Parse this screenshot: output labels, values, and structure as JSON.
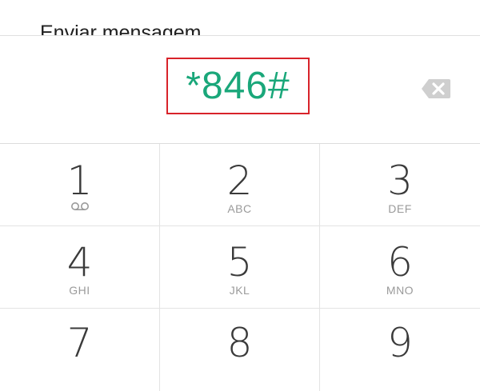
{
  "menu": {
    "send_message_label": "Enviar mensagem"
  },
  "display": {
    "number": "*846#"
  },
  "icons": {
    "backspace": "backspace-icon",
    "voicemail": "voicemail-icon"
  },
  "colors": {
    "number_text": "#1aa77a",
    "highlight_border": "#d8232a",
    "digit": "#3a3a3a",
    "letters": "#9a9a9a"
  },
  "keypad": {
    "keys": [
      {
        "digit": "1",
        "letters": ""
      },
      {
        "digit": "2",
        "letters": "ABC"
      },
      {
        "digit": "3",
        "letters": "DEF"
      },
      {
        "digit": "4",
        "letters": "GHI"
      },
      {
        "digit": "5",
        "letters": "JKL"
      },
      {
        "digit": "6",
        "letters": "MNO"
      },
      {
        "digit": "7",
        "letters": ""
      },
      {
        "digit": "8",
        "letters": ""
      },
      {
        "digit": "9",
        "letters": ""
      }
    ]
  }
}
